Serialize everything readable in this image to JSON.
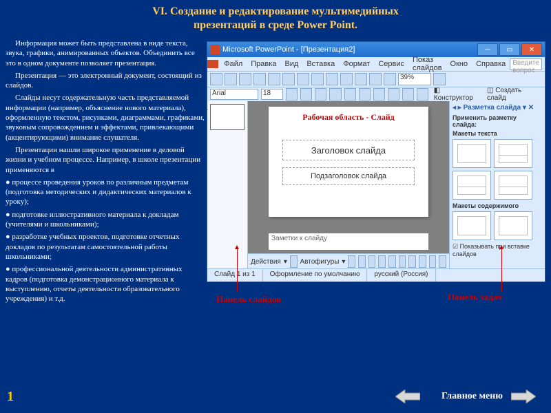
{
  "heading_l1": "VI. Создание и редактирование мультимедийных",
  "heading_l2": "презентаций в среде Power Point.",
  "text": {
    "p1": "Информация может быть представлена в виде текста, звука, графики, анимированных объектов. Объединить все это в одном документе позволяет презентация.",
    "p2": "Презентация — это электронный документ, состоящий из слайдов.",
    "p3": "Слайды несут содержательную часть представляемой информации (например, объяснение нового материала), оформленную текстом, рисунками, диаграммами, графиками, звуковым сопровождением и эффектами, привлекающими (акцентирующими) внимание слушателя.",
    "p4": "Презентации нашли широкое применение в деловой жизни и учебном процессе. Например, в школе презентации применяются в",
    "b1": "● процессе проведения уроков по различным предметам (подготовка методических и дидактических материалов к уроку);",
    "b2": "● подготовке иллюстративного материала к докладам (учителями и школьниками);",
    "b3": "● разработке учебных проектов, подготовке отчетных докладов по результатам самостоятельной работы школьниками;",
    "b4": "● профессиональной деятельности административных кадров (подготовка демонстрационного материала к выступлению, отчеты деятельности образовательного учреждения) и т.д."
  },
  "pp": {
    "title": "Microsoft PowerPoint - [Презентация2]",
    "menu": [
      "Файл",
      "Правка",
      "Вид",
      "Вставка",
      "Формат",
      "Сервис",
      "Показ слайдов",
      "Окно",
      "Справка"
    ],
    "question_placeholder": "Введите вопрос",
    "zoom": "39%",
    "font": "Arial",
    "fontsize": "18",
    "konstructor": "Конструктор",
    "createslide": "Создать слайд",
    "slide_label": "Рабочая область - Слайд",
    "ph_title": "Заголовок слайда",
    "ph_sub": "Подзаголовок слайда",
    "notes": "Заметки к слайду",
    "draw_actions": "Действия",
    "draw_auto": "Автофигуры",
    "task_title": "Разметка слайда",
    "task_apply": "Применить разметку слайда:",
    "task_sec1": "Макеты текста",
    "task_sec2": "Макеты содержимого",
    "task_check": "Показывать при вставке слайдов",
    "status": {
      "s1": "Слайд 1 из 1",
      "s2": "Оформление по умолчанию",
      "s3": "русский (Россия)"
    }
  },
  "annotations": {
    "slidepanel": "Панель слайдов",
    "taskpanel": "Панель задач"
  },
  "page_number": "1",
  "main_menu": "Главное меню"
}
